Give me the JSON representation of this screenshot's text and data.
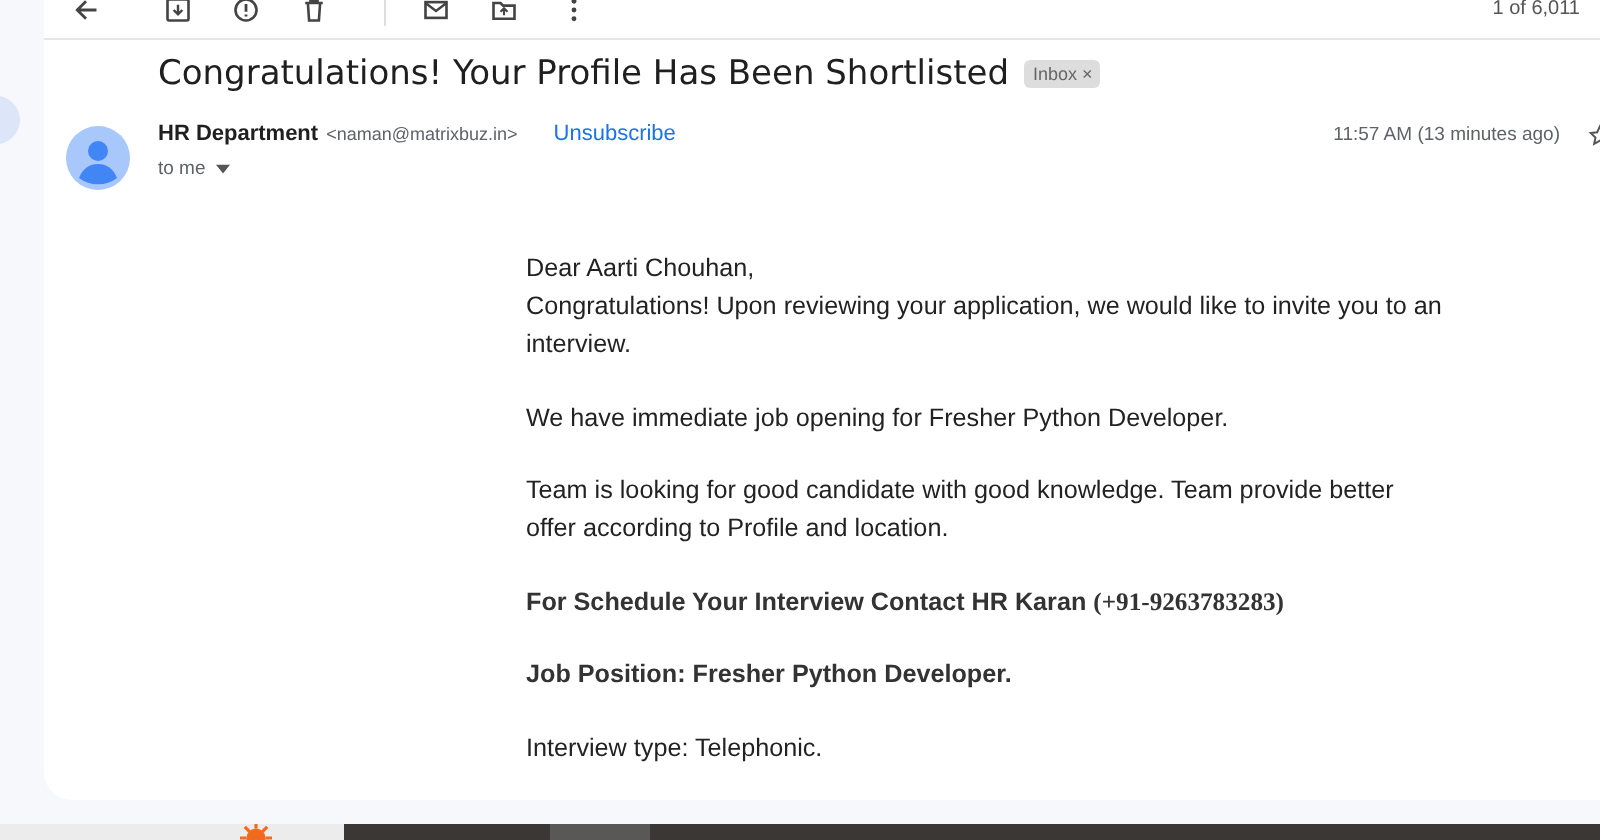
{
  "toolbar": {
    "counter": "1 of 6,011"
  },
  "message": {
    "subject": "Congratulations! Your Profile Has Been Shortlisted",
    "label": "Inbox",
    "label_close": "×",
    "sender_name": "HR Department",
    "sender_email": "<naman@matrixbuz.in>",
    "unsubscribe": "Unsubscribe",
    "recipient": "to me",
    "time": "11:57 AM (13 minutes ago)"
  },
  "body": [
    {
      "kind": "plain",
      "lines": [
        "Dear Aarti Chouhan,",
        "Congratulations! Upon reviewing your application, we would like to invite you to an interview."
      ]
    },
    {
      "kind": "plain",
      "lines": [
        "We have immediate job opening for Fresher Python Developer."
      ]
    },
    {
      "kind": "plain",
      "lines": [
        "Team is looking for good candidate with good knowledge. Team provide better offer according to Profile and location."
      ]
    },
    {
      "kind": "contact",
      "text": "For Schedule Your Interview Contact HR Karan",
      "phone": "(+91-9263783283)"
    },
    {
      "kind": "bold",
      "lines": [
        "Job Position: Fresher Python Developer."
      ]
    },
    {
      "kind": "plain",
      "lines": [
        "Interview type: Telephonic."
      ]
    }
  ]
}
